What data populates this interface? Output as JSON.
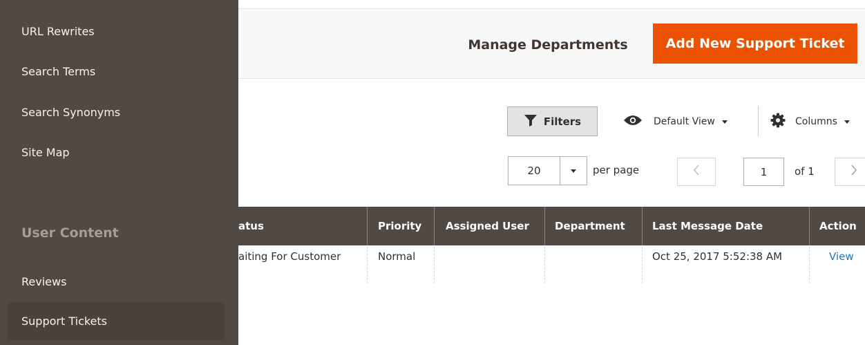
{
  "sidebar": {
    "items": [
      {
        "label": "URL Rewrites"
      },
      {
        "label": "Search Terms"
      },
      {
        "label": "Search Synonyms"
      },
      {
        "label": "Site Map"
      }
    ],
    "section_title": "User Content",
    "section_items": [
      {
        "label": "Reviews"
      },
      {
        "label": "Support Tickets"
      }
    ]
  },
  "header": {
    "manage_departments": "Manage Departments",
    "add_ticket": "Add New Support Ticket"
  },
  "toolbar": {
    "filters": "Filters",
    "view": "Default View",
    "columns": "Columns",
    "per_page_value": "20",
    "per_page_label": "per page",
    "page_current": "1",
    "page_of": "of 1"
  },
  "table": {
    "columns": [
      "atus",
      "Priority",
      "Assigned User",
      "Department",
      "Last Message Date",
      "Action"
    ],
    "rows": [
      {
        "status": "aiting For Customer",
        "priority": "Normal",
        "assigned_user": "",
        "department": "",
        "last_message_date": "Oct 25, 2017 5:52:38 AM",
        "action": "View"
      }
    ]
  },
  "colors": {
    "accent": "#eb5202",
    "sidebar_bg": "#514943",
    "table_header_bg": "#514943",
    "link": "#1979c3"
  }
}
